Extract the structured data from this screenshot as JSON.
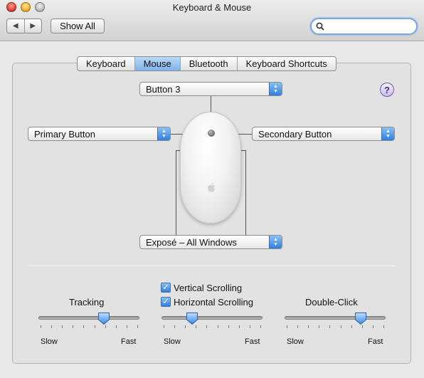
{
  "window": {
    "title": "Keyboard & Mouse",
    "nav_back_icon": "◀",
    "nav_forward_icon": "▶",
    "show_all_label": "Show All",
    "search": {
      "value": "",
      "placeholder": ""
    }
  },
  "tabs": [
    {
      "label": "Keyboard",
      "active": false
    },
    {
      "label": "Mouse",
      "active": true
    },
    {
      "label": "Bluetooth",
      "active": false
    },
    {
      "label": "Keyboard Shortcuts",
      "active": false
    }
  ],
  "buttons": {
    "button3": "Button 3",
    "left": "Primary Button",
    "right": "Secondary Button",
    "side": "Exposé – All Windows"
  },
  "help_label": "?",
  "tracking": {
    "label": "Tracking",
    "min_label": "Slow",
    "max_label": "Fast",
    "value": 0.65,
    "ticks": 10
  },
  "scrolling": {
    "vertical_label": "Vertical Scrolling",
    "vertical_checked": true,
    "horizontal_label": "Horizontal Scrolling",
    "horizontal_checked": true,
    "min_label": "Slow",
    "max_label": "Fast",
    "value": 0.3,
    "ticks": 10
  },
  "double_click": {
    "label": "Double-Click",
    "min_label": "Slow",
    "max_label": "Fast",
    "value": 0.75,
    "ticks": 10
  },
  "colors": {
    "accent": "#2f7fe0",
    "tab_active": "#8fbdee"
  }
}
